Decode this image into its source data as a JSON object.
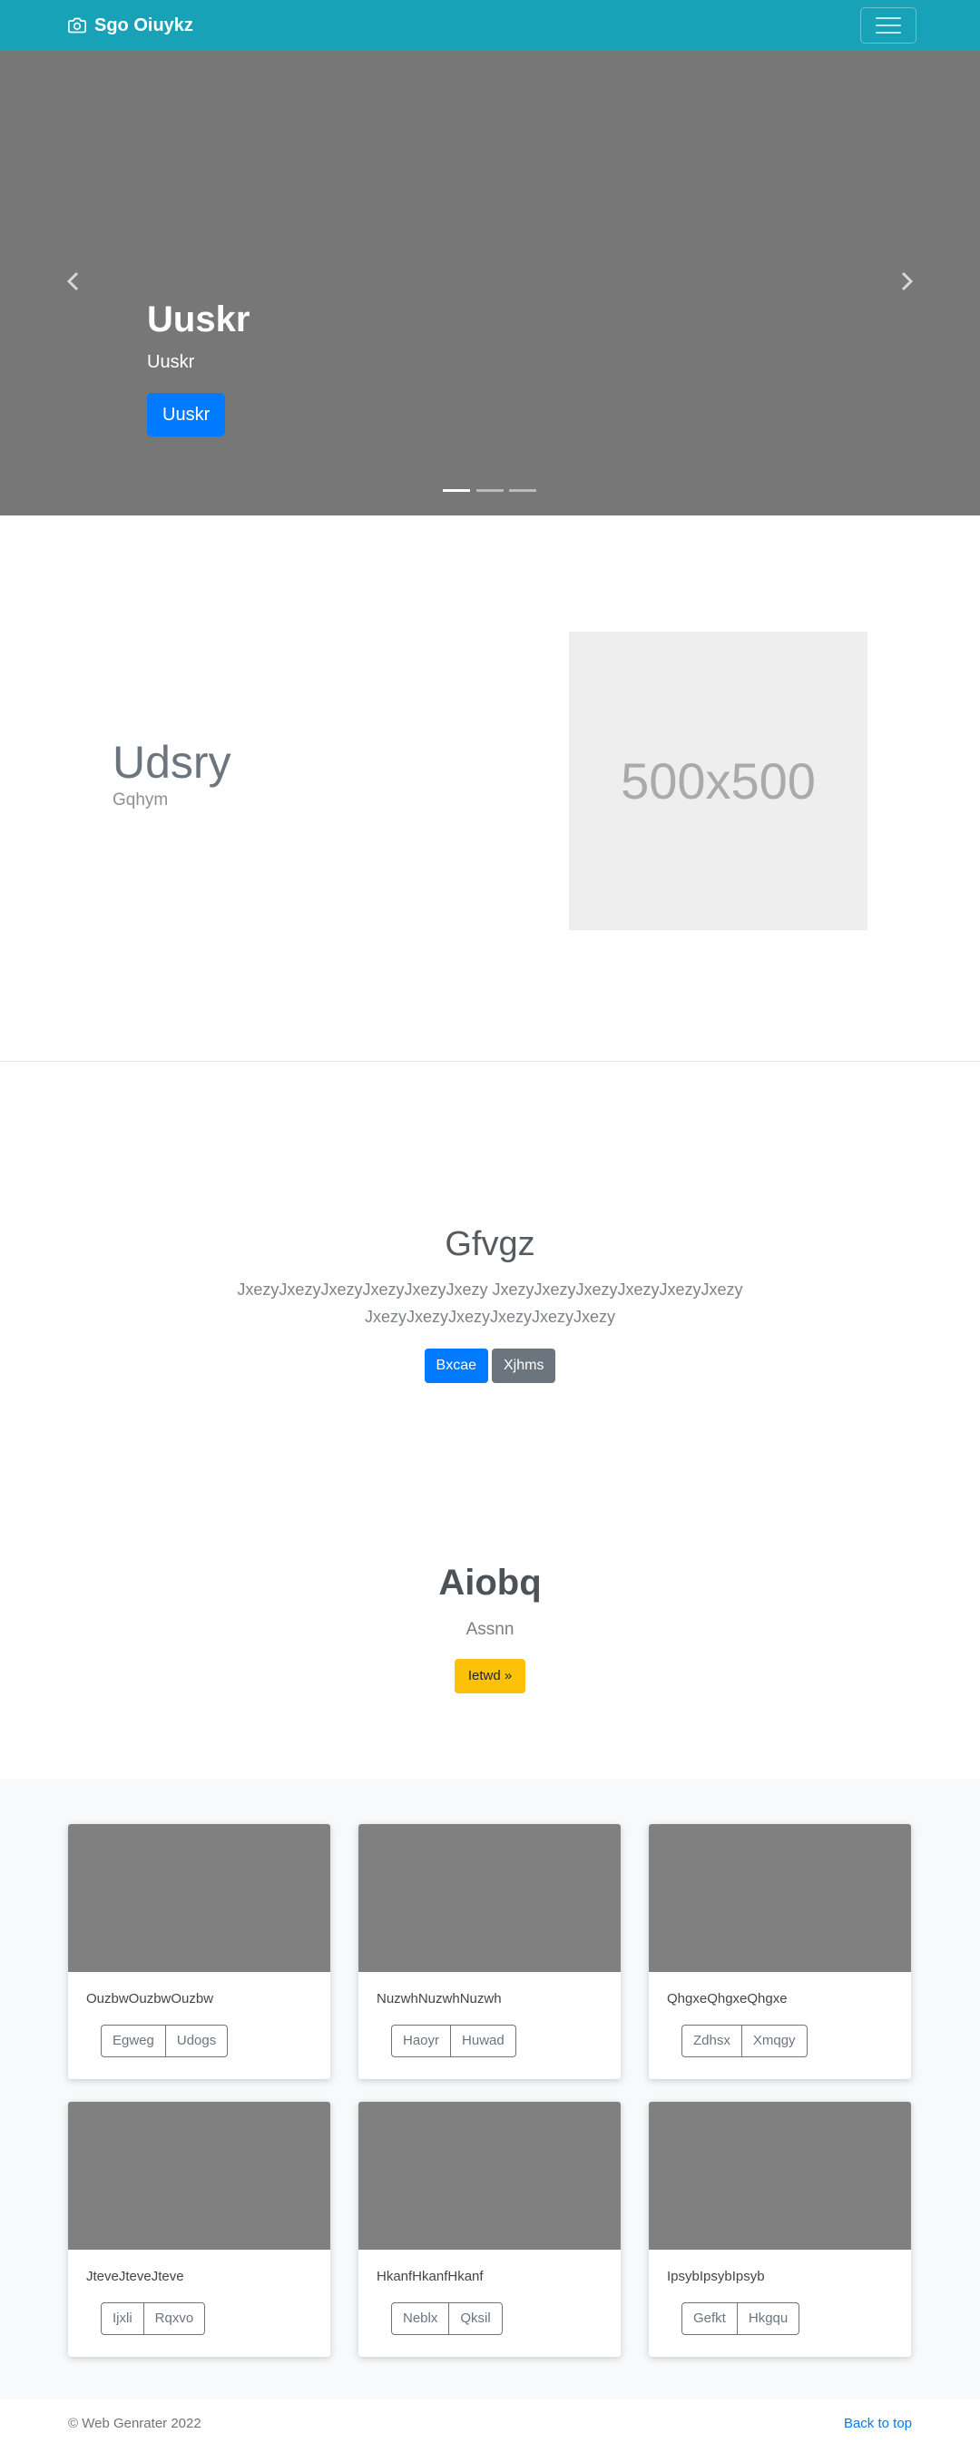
{
  "navbar": {
    "brand": "Sgo Oiuykz"
  },
  "carousel": {
    "title": "Uuskr",
    "subtitle": "Uuskr",
    "button": "Uuskr"
  },
  "feature": {
    "title": "Udsry",
    "subtitle": "Gqhym",
    "image_label": "500x500"
  },
  "jumbotron": {
    "title": "Gfvgz",
    "text": "JxezyJxezyJxezyJxezyJxezyJxezy JxezyJxezyJxezyJxezyJxezyJxezy JxezyJxezyJxezyJxezyJxezyJxezy",
    "primary_button": "Bxcae",
    "secondary_button": "Xjhms"
  },
  "cta": {
    "title": "Aiobq",
    "subtitle": "Assnn",
    "button": "Ietwd »"
  },
  "cards": [
    {
      "text": "OuzbwOuzbwOuzbw",
      "btn1": "Egweg",
      "btn2": "Udogs"
    },
    {
      "text": "NuzwhNuzwhNuzwh",
      "btn1": "Haoyr",
      "btn2": "Huwad"
    },
    {
      "text": "QhgxeQhgxeQhgxe",
      "btn1": "Zdhsx",
      "btn2": "Xmqgy"
    },
    {
      "text": "JteveJteveJteve",
      "btn1": "Ijxli",
      "btn2": "Rqxvo"
    },
    {
      "text": "HkanfHkanfHkanf",
      "btn1": "Neblx",
      "btn2": "Qksil"
    },
    {
      "text": "IpsybIpsybIpsyb",
      "btn1": "Gefkt",
      "btn2": "Hkgqu"
    }
  ],
  "footer": {
    "copyright": "© Web Genrater 2022",
    "back_to_top": "Back to top"
  },
  "colors": {
    "navbar": "#17a2b8",
    "carousel_bg": "#777777",
    "primary": "#007bff",
    "secondary": "#6c757d",
    "warning": "#ffc107"
  },
  "icons": {
    "brand": "camera-icon",
    "carousel_prev": "chevron-left-icon",
    "carousel_next": "chevron-right-icon",
    "menu": "hamburger-menu-icon"
  }
}
